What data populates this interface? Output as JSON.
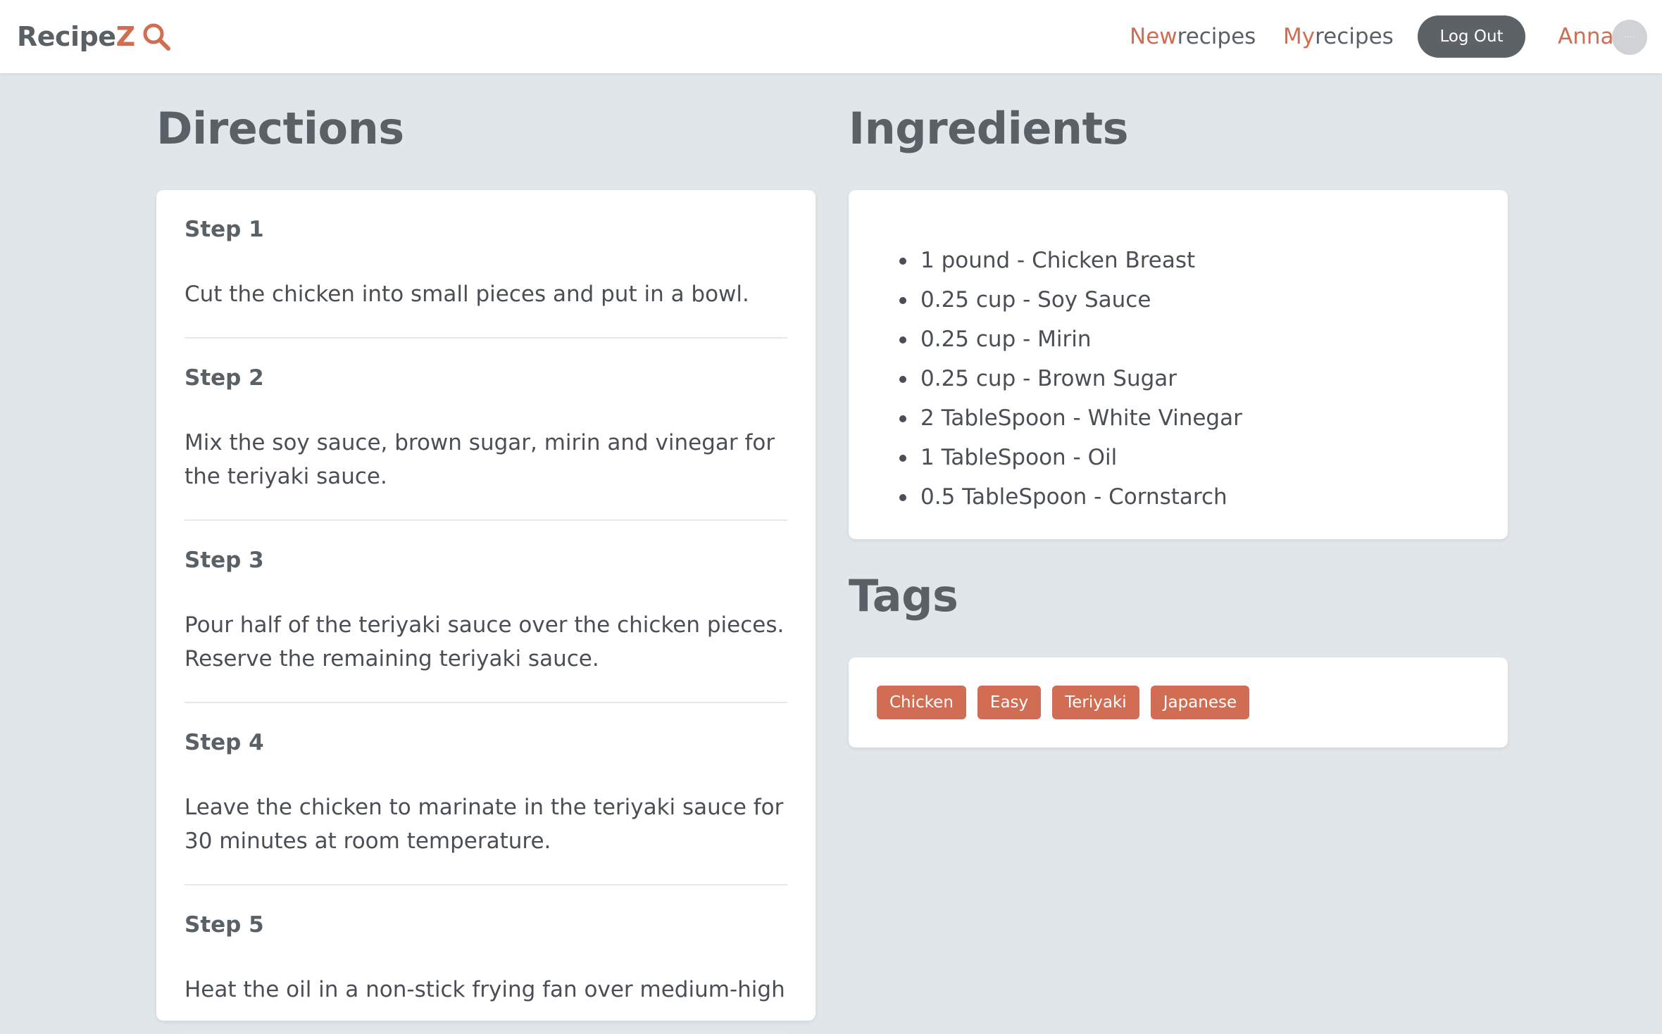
{
  "brand": {
    "part1": "Recipe",
    "part2": "Z",
    "icon": "search-icon"
  },
  "nav": {
    "new_accent": "New",
    "new_rest": "recipes",
    "my_accent": "My",
    "my_rest": "recipes",
    "logout_label": "Log Out",
    "user_name": "Anna",
    "avatar_text": "····"
  },
  "colors": {
    "accent": "#d16d52",
    "text_dark": "#5a6166",
    "page_bg": "#e1e6ea",
    "logout_bg": "#5c6266"
  },
  "directions": {
    "heading": "Directions",
    "steps": [
      {
        "title": "Step 1",
        "text": "Cut the chicken into small pieces and put in a bowl."
      },
      {
        "title": "Step 2",
        "text": "Mix the soy sauce, brown sugar, mirin and vinegar for the teriyaki sauce."
      },
      {
        "title": "Step 3",
        "text": "Pour half of the teriyaki sauce over the chicken pieces. Reserve the remaining teriyaki sauce."
      },
      {
        "title": "Step 4",
        "text": "Leave the chicken to marinate in the teriyaki sauce for 30 minutes at room temperature."
      },
      {
        "title": "Step 5",
        "text": "Heat the oil in a non-stick frying fan over medium-high"
      }
    ]
  },
  "ingredients": {
    "heading": "Ingredients",
    "items": [
      "1 pound - Chicken Breast",
      "0.25 cup - Soy Sauce",
      "0.25 cup - Mirin",
      "0.25 cup - Brown Sugar",
      "2 TableSpoon - White Vinegar",
      "1 TableSpoon - Oil",
      "0.5 TableSpoon - Cornstarch"
    ]
  },
  "tags": {
    "heading": "Tags",
    "items": [
      "Chicken",
      "Easy",
      "Teriyaki",
      "Japanese"
    ]
  }
}
